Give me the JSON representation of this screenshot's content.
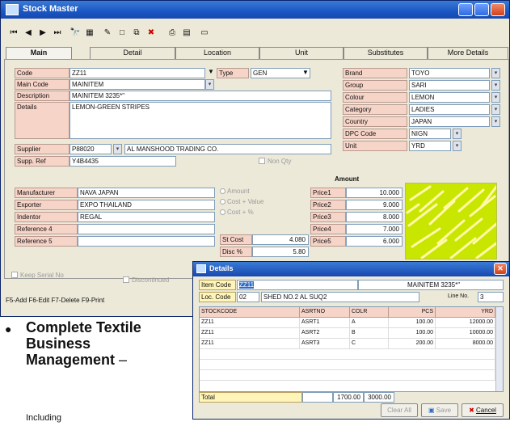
{
  "window": {
    "title": "Stock Master",
    "tabs": [
      "Main",
      "Detail",
      "Location",
      "Unit",
      "Substitutes",
      "More Details"
    ],
    "toolbar_icons": [
      "first-icon",
      "prev-icon",
      "next-icon",
      "last-icon",
      "binoculars-icon",
      "calendar-icon",
      "edit-icon",
      "new-icon",
      "copy-icon",
      "delete-icon",
      "print-icon",
      "grid-icon",
      "folder-icon"
    ]
  },
  "form": {
    "code_label": "Code",
    "code": "ZZ11",
    "type_label": "Type",
    "type": "GEN",
    "main_code_label": "Main Code",
    "main_code": "MAINITEM",
    "description_label": "Description",
    "description": "MAINITEM 3235*\"",
    "details_label": "Details",
    "details": "LEMON-GREEN STRIPES",
    "supplier_label": "Supplier",
    "supplier_code": "P88020",
    "supplier_name": "AL MANSHOOD TRADING CO.",
    "supp_ref_label": "Supp. Ref",
    "supp_ref": "Y4B4435",
    "non_qty_label": "Non Qty",
    "brand_label": "Brand",
    "brand": "TOYO",
    "group_label": "Group",
    "group": "SARI",
    "colour_label": "Colour",
    "colour": "LEMON",
    "category_label": "Category",
    "category": "LADIES",
    "country_label": "Country",
    "country": "JAPAN",
    "dpc_label": "DPC Code",
    "dpc": "NIGN",
    "unit_label": "Unit",
    "unit": "YRD",
    "manufacturer_label": "Manufacturer",
    "manufacturer": "NAVA JAPAN",
    "exporter_label": "Exporter",
    "exporter": "EXPO THAILAND",
    "indentor_label": "Indentor",
    "indentor": "REGAL",
    "ref4_label": "Reference 4",
    "ref4": "",
    "ref5_label": "Reference 5",
    "ref5": "",
    "amount_options": [
      "Amount",
      "Cost + Value",
      "Cost + %"
    ],
    "st_cost_label": "St Cost",
    "st_cost": "4.080",
    "disc_label": "Disc %",
    "disc": "5.80",
    "amount_header": "Amount",
    "prices": [
      {
        "label": "Price1",
        "value": "10.000"
      },
      {
        "label": "Price2",
        "value": "9.000"
      },
      {
        "label": "Price3",
        "value": "8.000"
      },
      {
        "label": "Price4",
        "value": "7.000"
      },
      {
        "label": "Price5",
        "value": "6.000"
      }
    ],
    "keep_serial_label": "Keep Serial No",
    "discontinued_label": "Discontinued"
  },
  "status_text": "F5-Add F6-Edit F7-Delete F9-Print",
  "details_dialog": {
    "title": "Details",
    "item_code_label": "Item Code",
    "item_code": "ZZ11",
    "item_desc": "MAINITEM 3235*\"",
    "loc_label": "Loc. Code",
    "loc_code": "02",
    "loc_name": "SHED NO.2 AL SUQ2",
    "line_no_label": "Line No.",
    "line_no": "3",
    "columns": [
      "STOCKCODE",
      "ASRTNO",
      "COLR",
      "PCS",
      "YRD"
    ],
    "rows": [
      [
        "ZZ11",
        "ASRT1",
        "A",
        "100.00",
        "12000.00"
      ],
      [
        "ZZ11",
        "ASRT2",
        "B",
        "100.00",
        "10000.00"
      ],
      [
        "ZZ11",
        "ASRT3",
        "C",
        "200.00",
        "8000.00"
      ]
    ],
    "total_label": "Total",
    "total_pcs": "1700.00",
    "total_yrd": "3000.00",
    "clear_label": "Clear All",
    "save_label": "Save",
    "cancel_label": "Cancel"
  },
  "bullet": {
    "text": "Complete Textile Business Management",
    "suffix": " –",
    "next_line": "Including"
  }
}
